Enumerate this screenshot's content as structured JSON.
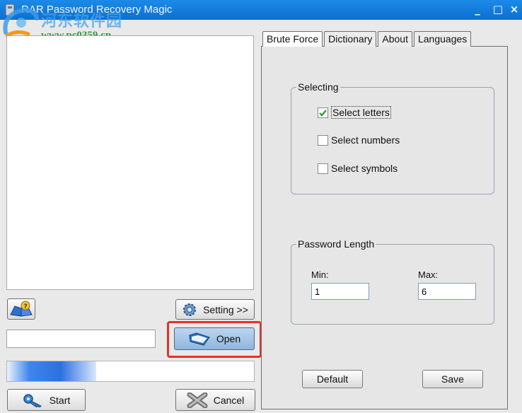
{
  "window": {
    "title": "RAR Password Recovery Magic",
    "minimize": "_",
    "maximize": "□",
    "close": "×"
  },
  "watermark": {
    "cn_text": "河东软件园",
    "url": "www.pc0359.cn"
  },
  "left": {
    "setting_label": "Setting >>",
    "open_label": "Open",
    "path_value": "",
    "progress_percent": 36,
    "start_label": "Start",
    "cancel_label": "Cancel"
  },
  "tabs": [
    {
      "label": "Brute Force",
      "active": true
    },
    {
      "label": "Dictionary",
      "active": false
    },
    {
      "label": "About",
      "active": false
    },
    {
      "label": "Languages",
      "active": false
    }
  ],
  "selecting": {
    "title": "Selecting",
    "options": [
      {
        "label": "Select letters",
        "checked": true
      },
      {
        "label": "Select numbers",
        "checked": false
      },
      {
        "label": "Select symbols",
        "checked": false
      }
    ]
  },
  "password_length": {
    "title": "Password Length",
    "min_label": "Min:",
    "min_value": "1",
    "max_label": "Max:",
    "max_value": "6"
  },
  "buttons": {
    "default_label": "Default",
    "save_label": "Save"
  },
  "icons": {
    "help": "help-book-icon",
    "setting": "gear-icon",
    "open": "folder-open-icon",
    "start": "key-icon",
    "cancel": "cancel-x-icon"
  },
  "colors": {
    "titlebar": "#0c6fd0",
    "highlight": "#e8302a",
    "progress": "#3f86ec"
  }
}
